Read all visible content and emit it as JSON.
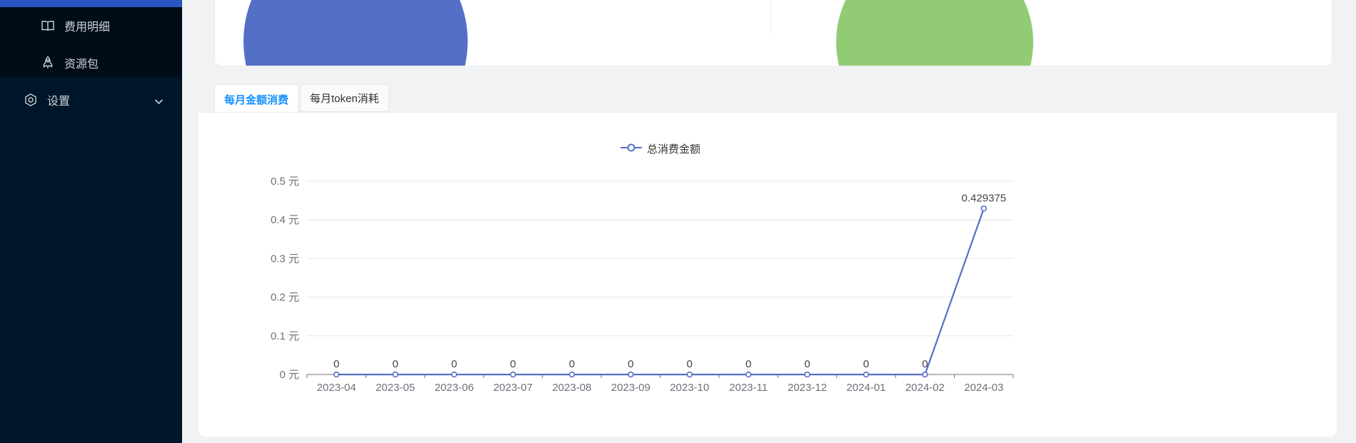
{
  "sidebar": {
    "items": [
      {
        "label": "费用明细",
        "icon": "account-book-icon"
      },
      {
        "label": "资源包",
        "icon": "rocket-icon"
      },
      {
        "label": "设置",
        "icon": "gear-icon",
        "expandable": true
      }
    ]
  },
  "tabs": [
    {
      "label": "每月金额消费",
      "active": true
    },
    {
      "label": "每月token消耗",
      "active": false
    }
  ],
  "colors": {
    "sidebar_bg": "#001529",
    "submenu_bg": "#000c17",
    "selected_item_blue": "#2a55c2",
    "tab_active_text": "#1890ff",
    "line_series": "#5470c6",
    "pie_blue": "#5470c6",
    "pie_green": "#91cc75",
    "gridline": "#e0e6f1",
    "axis": "#6e7079"
  },
  "chart_data": [
    {
      "type": "pie",
      "note_colors": [
        "#5470c6"
      ],
      "visible": "partial single blue slice, labels cut off"
    },
    {
      "type": "pie",
      "note_colors": [
        "#91cc75"
      ],
      "visible": "partial single green slice, labels cut off"
    },
    {
      "type": "line",
      "legend": [
        "总消费金额"
      ],
      "categories": [
        "2023-04",
        "2023-05",
        "2023-06",
        "2023-07",
        "2023-08",
        "2023-09",
        "2023-10",
        "2023-11",
        "2023-12",
        "2024-01",
        "2024-02",
        "2024-03"
      ],
      "series": [
        {
          "name": "总消费金额",
          "values": [
            0,
            0,
            0,
            0,
            0,
            0,
            0,
            0,
            0,
            0,
            0,
            0.429375
          ]
        }
      ],
      "point_labels": [
        "0",
        "0",
        "0",
        "0",
        "0",
        "0",
        "0",
        "0",
        "0",
        "0",
        "0",
        "0.429375"
      ],
      "y_ticks": [
        "0 元",
        "0.1 元",
        "0.2 元",
        "0.3 元",
        "0.4 元",
        "0.5 元"
      ],
      "ylim": [
        0,
        0.5
      ],
      "grid": true,
      "legend_position": "top-center",
      "line_color": "#5470c6"
    }
  ]
}
